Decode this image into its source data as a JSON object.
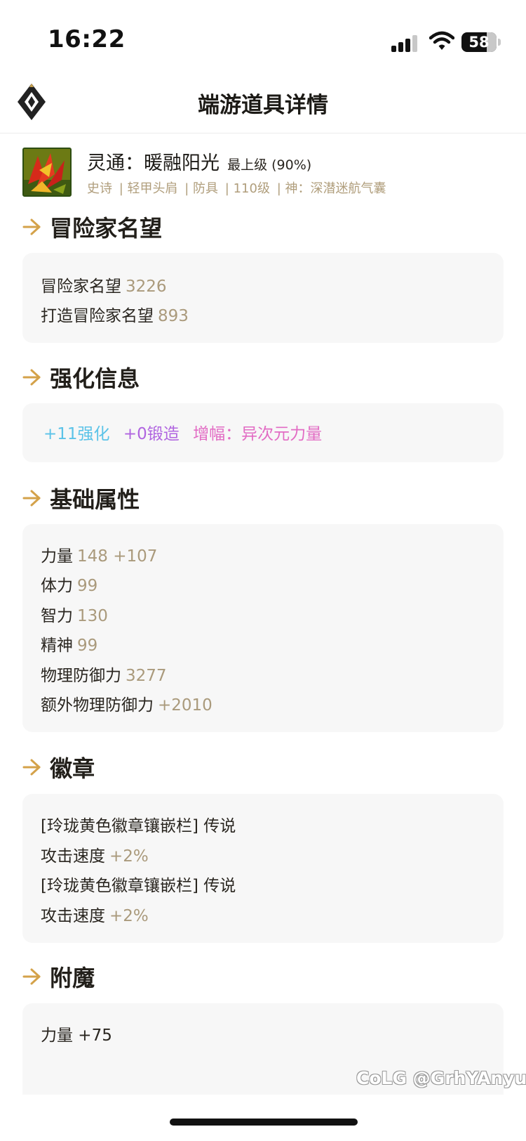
{
  "status_bar": {
    "time": "16:22",
    "battery": "58"
  },
  "nav": {
    "title": "端游道具详情"
  },
  "item": {
    "name": "灵通：暖融阳光",
    "grade": "最上级 (90%)",
    "meta": [
      "史诗",
      "| 轻甲头肩",
      "| 防具",
      "| 110级",
      "| 神：深潜迷航气囊"
    ]
  },
  "sections": {
    "reputation": {
      "title": "冒险家名望",
      "lines": [
        {
          "label": "冒险家名望",
          "value": "3226"
        },
        {
          "label": "打造冒险家名望",
          "value": "893"
        }
      ]
    },
    "enhance": {
      "title": "强化信息",
      "reinforce": "+11强化",
      "forge": "+0锻造",
      "amplify": "增幅：异次元力量"
    },
    "base": {
      "title": "基础属性",
      "lines": [
        {
          "label": "力量",
          "value": "148 +107"
        },
        {
          "label": "体力",
          "value": "99"
        },
        {
          "label": "智力",
          "value": "130"
        },
        {
          "label": "精神",
          "value": "99"
        },
        {
          "label": "物理防御力",
          "value": "3277"
        },
        {
          "label": "额外物理防御力",
          "value": "+2010"
        }
      ]
    },
    "emblem": {
      "title": "徽章",
      "lines": [
        {
          "label": "[玲珑黄色徽章镶嵌栏] 传说",
          "value": ""
        },
        {
          "label": "攻击速度",
          "value": "+2%"
        },
        {
          "label": "[玲珑黄色徽章镶嵌栏] 传说",
          "value": ""
        },
        {
          "label": "攻击速度",
          "value": "+2%"
        }
      ]
    },
    "enchant": {
      "title": "附魔",
      "lines": [
        {
          "label": "力量 +75",
          "value": ""
        }
      ]
    }
  },
  "watermark": "CoLG @GrhYAnyu",
  "colors": {
    "reinforce": "#5bc3e8",
    "forge": "#b065e0",
    "amplify": "#e26cc4",
    "value": "#aa9a7c",
    "accent": "#d4a24a"
  },
  "icons": [
    "logo-diamond-icon",
    "signal-icon",
    "wifi-icon",
    "battery-icon",
    "section-arrow-icon"
  ]
}
